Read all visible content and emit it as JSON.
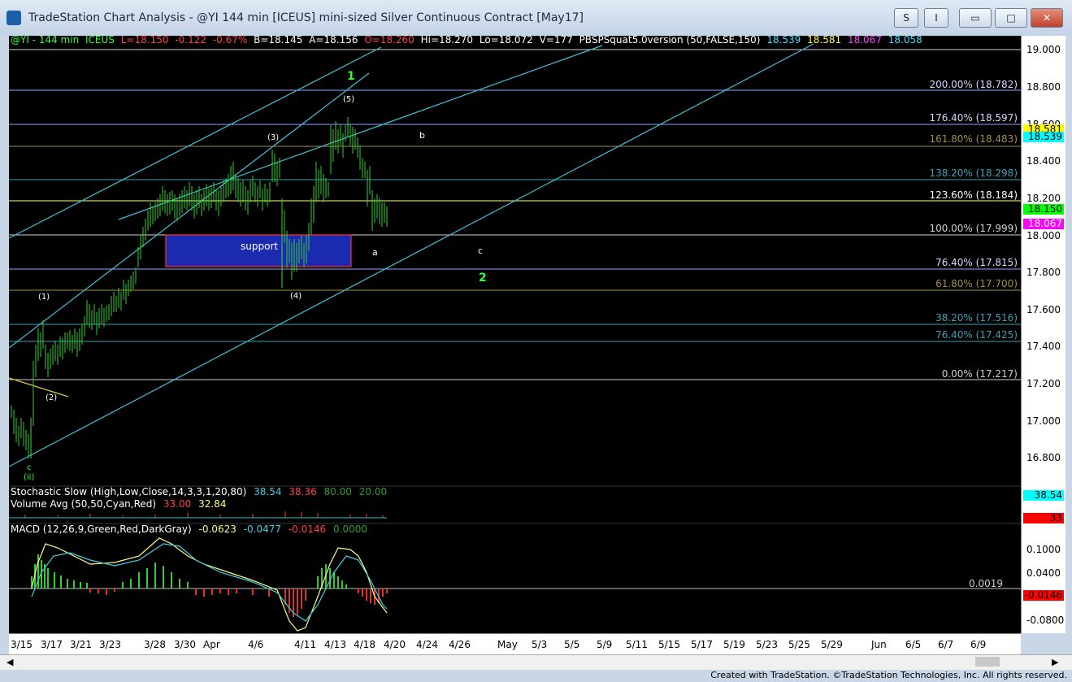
{
  "window": {
    "title": "TradeStation Chart Analysis - @YI 144 min [ICEUS] mini-sized Silver Continuous Contract [May17]",
    "btn_s": "S",
    "btn_i": "I",
    "min": "▭",
    "max": "□",
    "close": "✕"
  },
  "header": {
    "symbol": "@YI - 144 min",
    "exchange": "ICEUS",
    "last": "L=18.150",
    "chg": "-0.122",
    "pct": "-0.67%",
    "bid": "B=18.145",
    "ask": "A=18.156",
    "open": "O=18.260",
    "hi": "Hi=18.270",
    "lo": "Lo=18.072",
    "vol": "V=177",
    "study": "PBSPSquat5.0version (50,FALSE,150)",
    "v1": "18.539",
    "v2": "18.581",
    "v3": "18.067",
    "v4": "18.058"
  },
  "price_axis": [
    "19.000",
    "18.800",
    "18.600",
    "18.400",
    "18.200",
    "18.000",
    "17.800",
    "17.600",
    "17.400",
    "17.200",
    "17.000",
    "16.800"
  ],
  "fib_levels": [
    {
      "label": "200.00% (18.782)",
      "color": "#8fa8ff"
    },
    {
      "label": "176.40% (18.597)",
      "color": "#8fa8ff"
    },
    {
      "label": "161.80% (18.483)",
      "color": "#a09040"
    },
    {
      "label": "138.20% (18.298)",
      "color": "#3ca0b4"
    },
    {
      "label": "123.60% (18.184)",
      "color": "#ffffff"
    },
    {
      "label": "100.00% (17.999)",
      "color": "#cfcfcf"
    },
    {
      "label": "76.40% (17.815)",
      "color": "#8fa8ff"
    },
    {
      "label": "61.80% (17.700)",
      "color": "#a09040"
    },
    {
      "label": "38.20% (17.516)",
      "color": "#3ca0b4"
    },
    {
      "label": "76.40% (17.425)",
      "color": "#3ca0b4"
    },
    {
      "label": "0.00% (17.217)",
      "color": "#cfcfcf"
    }
  ],
  "price_tags": [
    {
      "v": "18.581",
      "bg": "#ffff00",
      "fg": "#000"
    },
    {
      "v": "18.539",
      "bg": "#00ffff",
      "fg": "#000"
    },
    {
      "v": "18.150",
      "bg": "#00ff00",
      "fg": "#000"
    },
    {
      "v": "18.067",
      "bg": "#ff00ff",
      "fg": "#fff"
    }
  ],
  "wave_labels": {
    "w1": "1",
    "w2": "2",
    "p1": "(1)",
    "p2": "(2)",
    "p3": "(3)",
    "p4": "(4)",
    "p5": "(5)",
    "a": "a",
    "b": "b",
    "c": "c",
    "c2": "c",
    "ii": "(ii)",
    "support": "support"
  },
  "stochastic": {
    "name": "Stochastic Slow (High,Low,Close,14,3,3,1,20,80)",
    "v1": "38.54",
    "v2": "38.36",
    "v3": "80.00",
    "v4": "20.00",
    "tag": "38.54"
  },
  "volume": {
    "name": "Volume Avg (50,50,Cyan,Red)",
    "v1": "33.00",
    "v2": "32.84",
    "tag": "33"
  },
  "macd": {
    "name": "MACD (12,26,9,Green,Red,DarkGray)",
    "v1": "-0.0623",
    "v2": "-0.0477",
    "v3": "-0.0146",
    "v4": "0.0000",
    "zero_label": "0.0019",
    "tag": "-0.0146",
    "axis": [
      "0.1000",
      "0.0400",
      "-0.0800"
    ]
  },
  "dates": [
    "3/15",
    "3/17",
    "3/21",
    "3/23",
    "3/28",
    "3/30",
    "Apr",
    "4/6",
    "4/11",
    "4/13",
    "4/18",
    "4/20",
    "4/24",
    "4/26",
    "May",
    "5/3",
    "5/5",
    "5/9",
    "5/11",
    "5/15",
    "5/17",
    "5/19",
    "5/23",
    "5/25",
    "5/29",
    "Jun",
    "6/5",
    "6/7",
    "6/9"
  ],
  "footer": "Created with TradeStation. ©TradeStation Technologies, Inc. All rights reserved."
}
